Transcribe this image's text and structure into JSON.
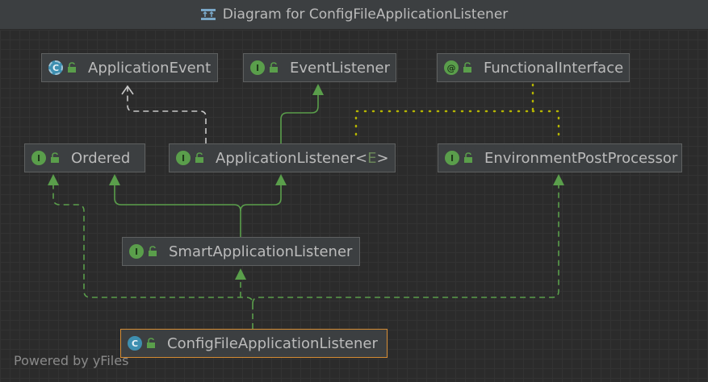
{
  "window": {
    "title": "Diagram for ConfigFileApplicationListener"
  },
  "nodes": {
    "application_event": {
      "label": "ApplicationEvent",
      "badge": "C"
    },
    "event_listener": {
      "label": "EventListener",
      "badge": "I"
    },
    "functional_interface": {
      "label": "FunctionalInterface",
      "badge": "@"
    },
    "ordered": {
      "label": "Ordered",
      "badge": "I"
    },
    "application_listener": {
      "label": "ApplicationListener",
      "generic_open": "<",
      "generic_param": "E",
      "generic_close": ">",
      "badge": "I"
    },
    "environment_post_processor": {
      "label": "EnvironmentPostProcessor",
      "badge": "I"
    },
    "smart_application_listener": {
      "label": "SmartApplicationListener",
      "badge": "I"
    },
    "config_file_application_listener": {
      "label": "ConfigFileApplicationListener",
      "badge": "C"
    }
  },
  "footer": {
    "text": "Powered by yFiles"
  },
  "colors": {
    "background": "#2b2b2b",
    "node_fill": "#3c3f41",
    "node_border": "#5e6060",
    "selected_border": "#d68c33",
    "extends_edge": "#5a9e4b",
    "implements_edge": "#5a9e4b",
    "abstract_edge": "#c8c8c8",
    "annotation_edge": "#b5b500"
  },
  "icons": {
    "title_icon": "diagram-icon",
    "lock": "unlocked-icon"
  }
}
